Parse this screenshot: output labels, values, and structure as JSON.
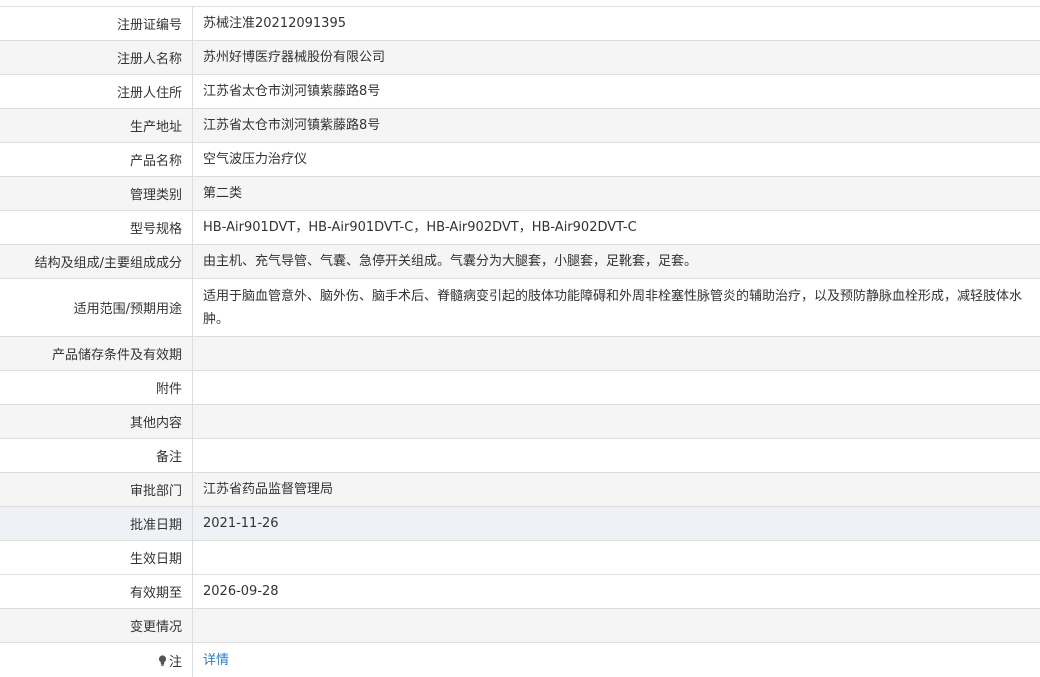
{
  "rows": [
    {
      "label": "注册证编号",
      "value": "苏械注准20212091395"
    },
    {
      "label": "注册人名称",
      "value": "苏州好博医疗器械股份有限公司"
    },
    {
      "label": "注册人住所",
      "value": "江苏省太仓市浏河镇紫藤路8号"
    },
    {
      "label": "生产地址",
      "value": "江苏省太仓市浏河镇紫藤路8号"
    },
    {
      "label": "产品名称",
      "value": "空气波压力治疗仪"
    },
    {
      "label": "管理类别",
      "value": "第二类"
    },
    {
      "label": "型号规格",
      "value": "HB-Air901DVT，HB-Air901DVT-C，HB-Air902DVT，HB-Air902DVT-C"
    },
    {
      "label": "结构及组成/主要组成成分",
      "value": "由主机、充气导管、气囊、急停开关组成。气囊分为大腿套，小腿套，足靴套，足套。"
    },
    {
      "label": "适用范围/预期用途",
      "value": "适用于脑血管意外、脑外伤、脑手术后、脊髓病变引起的肢体功能障碍和外周非栓塞性脉管炎的辅助治疗，以及预防静脉血栓形成，减轻肢体水肿。"
    },
    {
      "label": "产品储存条件及有效期",
      "value": ""
    },
    {
      "label": "附件",
      "value": ""
    },
    {
      "label": "其他内容",
      "value": ""
    },
    {
      "label": "备注",
      "value": ""
    },
    {
      "label": "审批部门",
      "value": "江苏省药品监督管理局"
    },
    {
      "label": "批准日期",
      "value": "2021-11-26"
    },
    {
      "label": "生效日期",
      "value": ""
    },
    {
      "label": "有效期至",
      "value": "2026-09-28"
    },
    {
      "label": "变更情况",
      "value": ""
    }
  ],
  "note": {
    "label": "注",
    "link": "详情",
    "icon": "lightbulb-icon"
  },
  "colors": {
    "border": "#dddddd",
    "shade": "#f5f5f5",
    "highlight": "#eef1f6",
    "link": "#2a7cc7"
  }
}
